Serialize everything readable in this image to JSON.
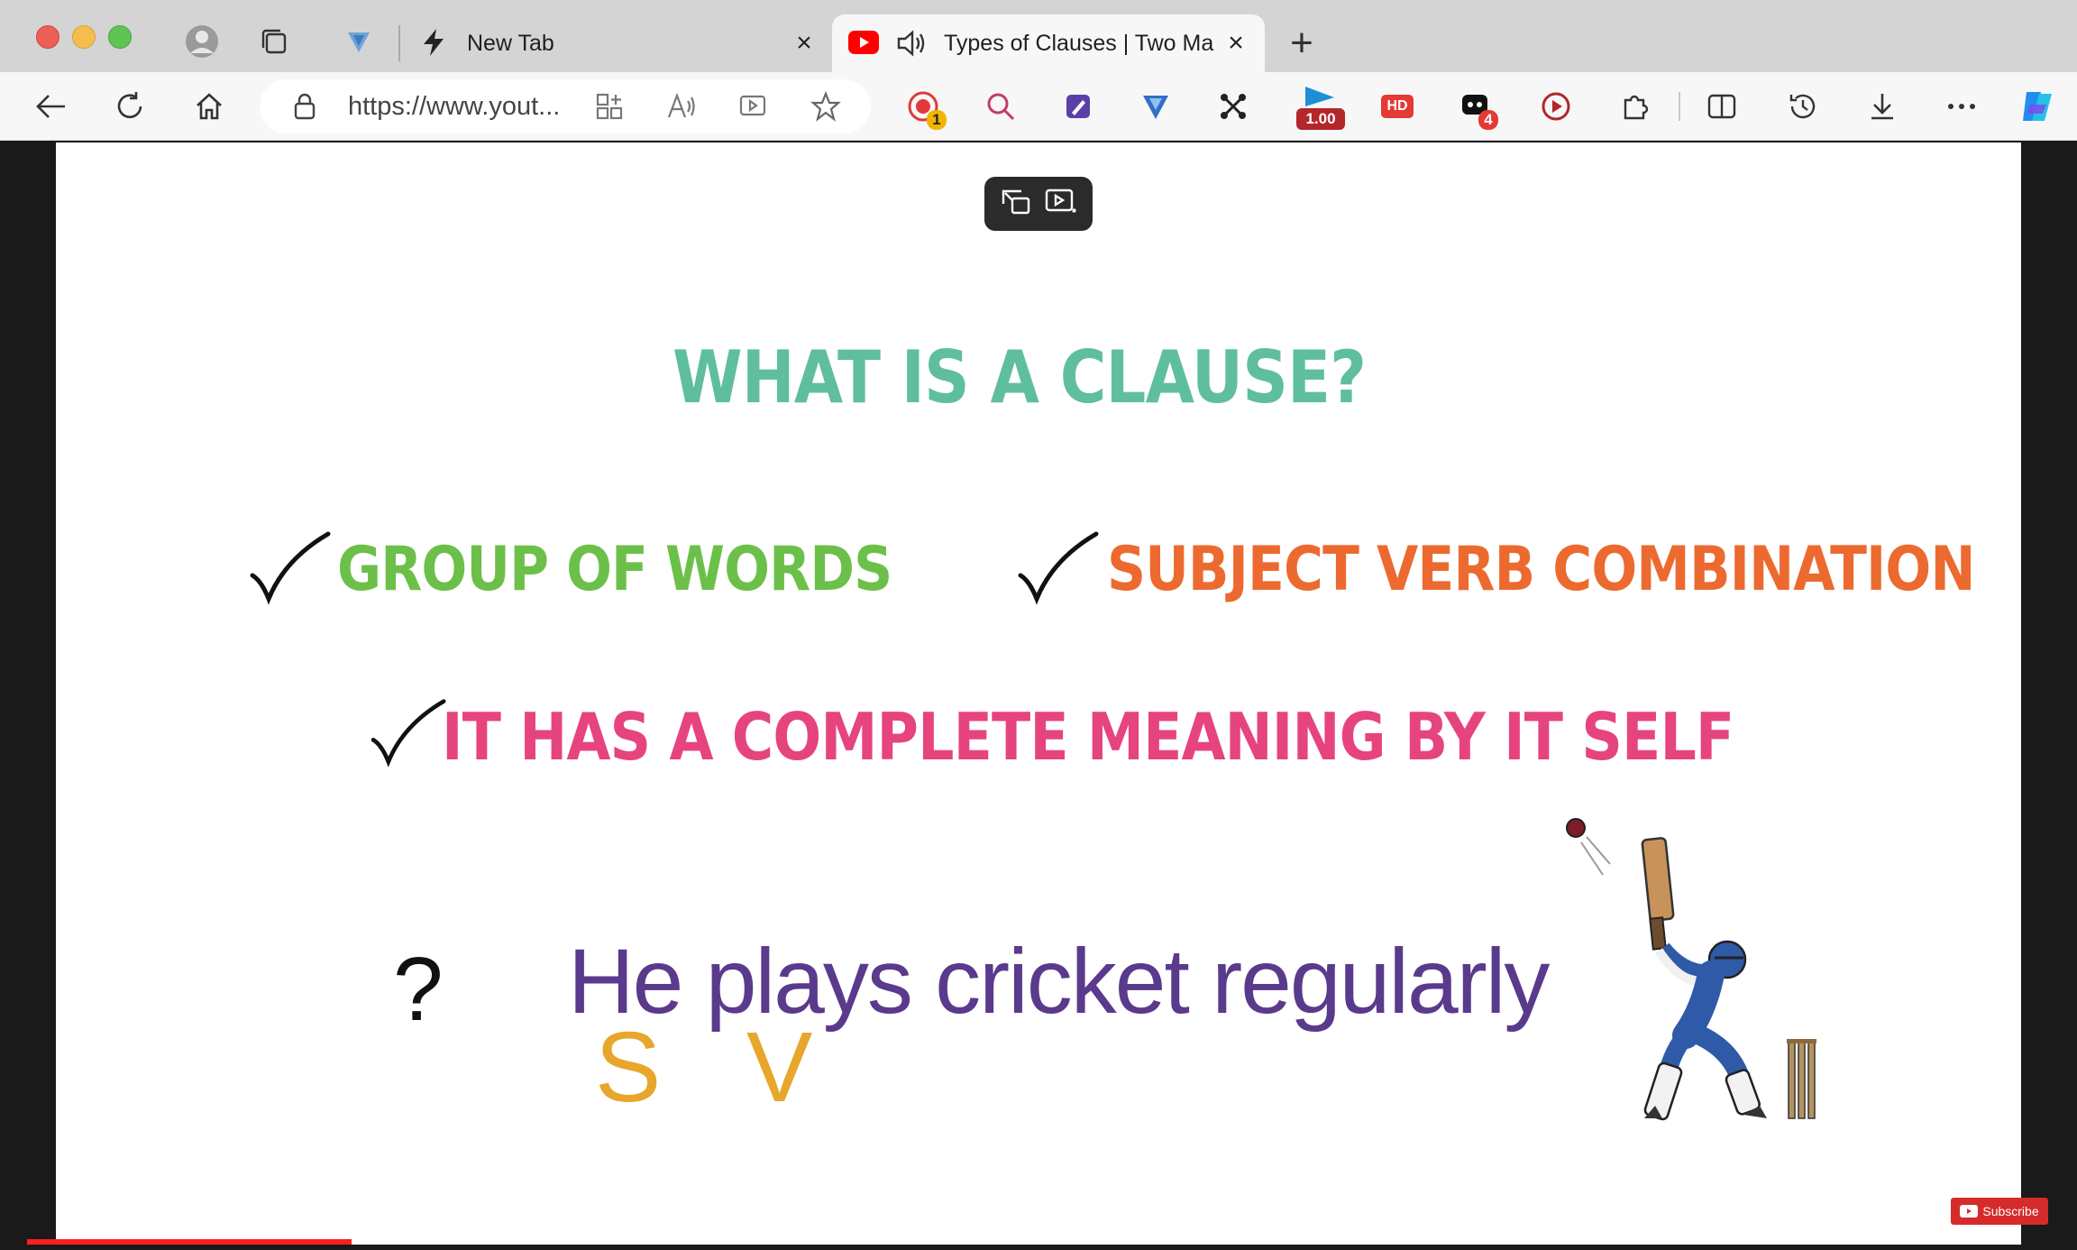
{
  "browser": {
    "tabs": [
      {
        "title": "New Tab",
        "icon": "lightning-icon",
        "active": false
      },
      {
        "title": "Types of Clauses | Two Ma",
        "icon": "youtube-icon",
        "active": true,
        "audio": true
      }
    ],
    "address_bar": {
      "url": "https://www.yout..."
    },
    "extension_badges": {
      "recorder_count": "1",
      "speed": "1.00",
      "hd_label": "HD",
      "notes_count": "4"
    }
  },
  "video": {
    "slide": {
      "heading": "WHAT IS A CLAUSE?",
      "criteria": [
        {
          "text": "GROUP OF WORDS",
          "color": "#6cc04a"
        },
        {
          "text": "SUBJECT VERB COMBINATION",
          "color": "#ec6a2f"
        },
        {
          "text": "IT HAS A COMPLETE MEANING BY IT SELF",
          "color": "#e6447f"
        }
      ],
      "question_mark": "?",
      "example_sentence": "He plays cricket regularly",
      "subject_marker": "S",
      "verb_marker": "V"
    },
    "subscribe_label": "Subscribe",
    "progress_fraction": 0.155
  },
  "colors": {
    "heading": "#5fbf9c",
    "sentence": "#5a3a8c",
    "markers": "#e7a62c",
    "progress": "#ff1f1f"
  }
}
